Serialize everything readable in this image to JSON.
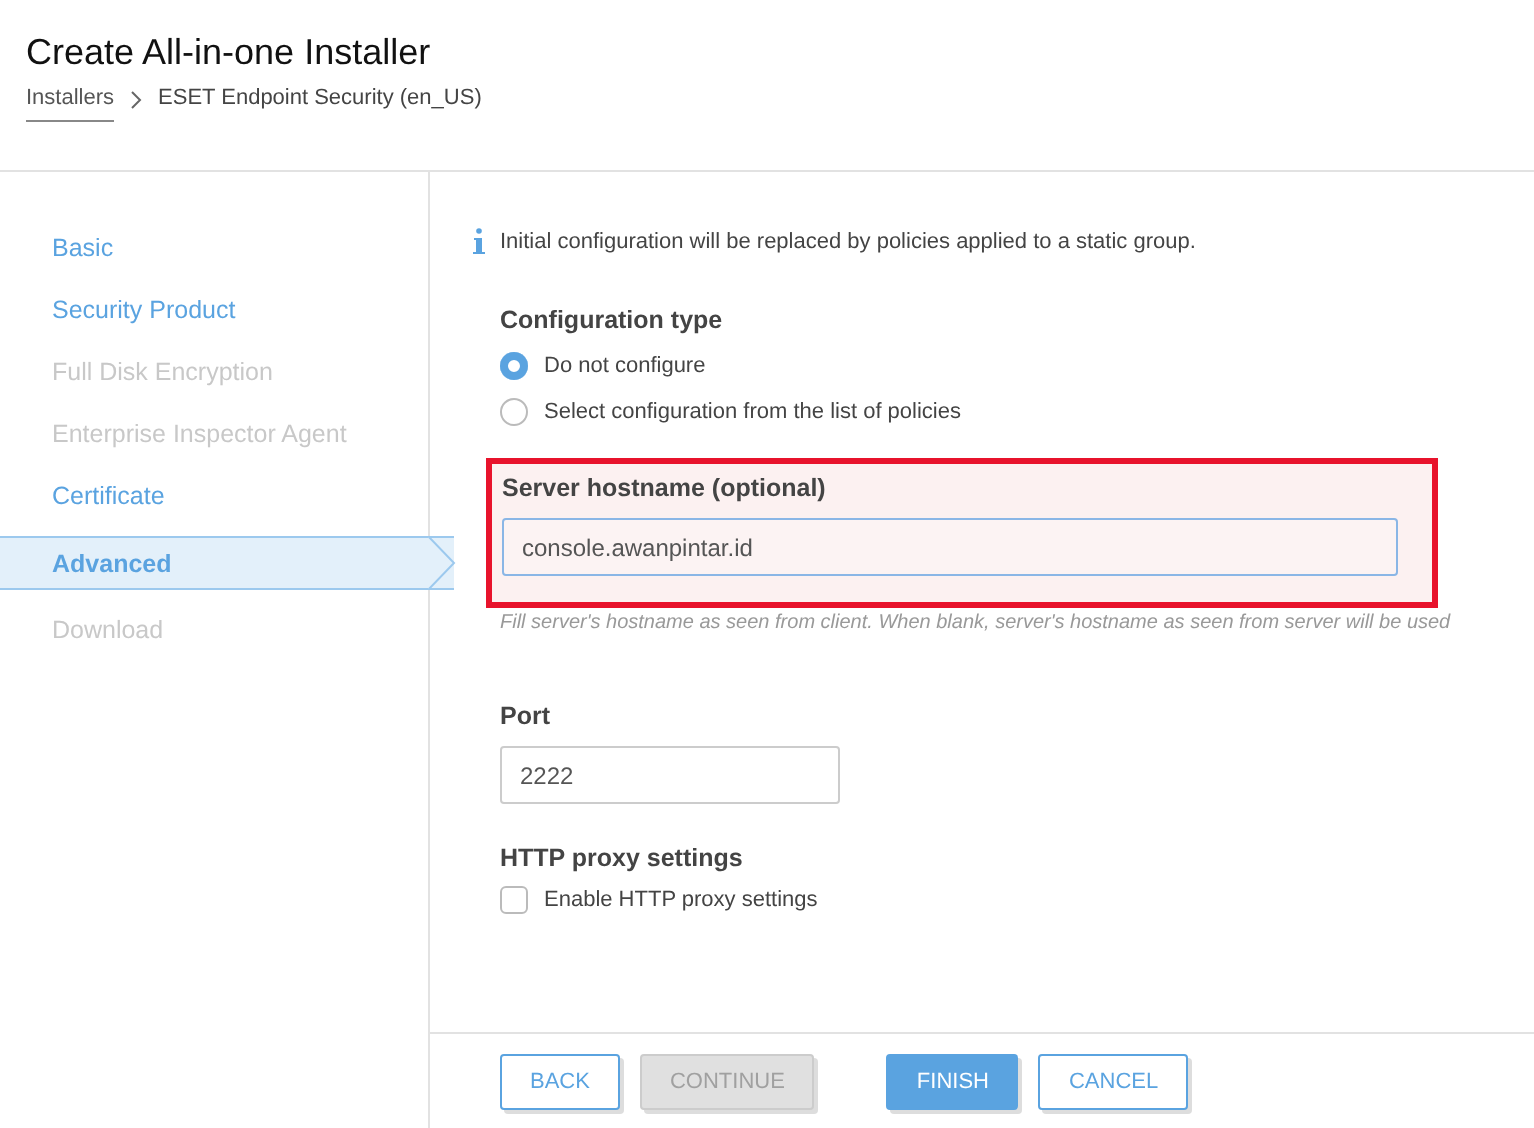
{
  "header": {
    "title": "Create All-in-one Installer",
    "breadcrumb": [
      {
        "label": "Installers",
        "link": true
      },
      {
        "label": "ESET Endpoint Security (en_US)",
        "link": false
      }
    ]
  },
  "sidebar": {
    "items": [
      {
        "label": "Basic",
        "selected": false,
        "disabled": false
      },
      {
        "label": "Security Product",
        "selected": false,
        "disabled": false
      },
      {
        "label": "Full Disk Encryption",
        "selected": false,
        "disabled": true
      },
      {
        "label": "Enterprise Inspector Agent",
        "selected": false,
        "disabled": true
      },
      {
        "label": "Certificate",
        "selected": false,
        "disabled": false
      },
      {
        "label": "Advanced",
        "selected": true,
        "disabled": false
      },
      {
        "label": "Download",
        "selected": false,
        "disabled": true
      }
    ]
  },
  "info": "Initial configuration will be replaced by policies applied to a static group.",
  "configuration_type": {
    "label": "Configuration type",
    "options": [
      {
        "label": "Do not configure",
        "selected": true
      },
      {
        "label": "Select configuration from the list of policies",
        "selected": false
      }
    ]
  },
  "server_hostname": {
    "label": "Server hostname (optional)",
    "value": "console.awanpintar.id",
    "highlighted": true,
    "hint": "Fill server's hostname as seen from client. When blank, server's hostname as seen from server will be used"
  },
  "port": {
    "label": "Port",
    "value": "2222"
  },
  "proxy": {
    "label": "HTTP proxy settings",
    "checkbox": {
      "label": "Enable HTTP proxy settings",
      "checked": false
    }
  },
  "buttons": [
    {
      "label": "BACK",
      "kind": "outline"
    },
    {
      "label": "CONTINUE",
      "kind": "disabled"
    },
    {
      "label": "FINISH",
      "kind": "primary"
    },
    {
      "label": "CANCEL",
      "kind": "outline"
    }
  ]
}
